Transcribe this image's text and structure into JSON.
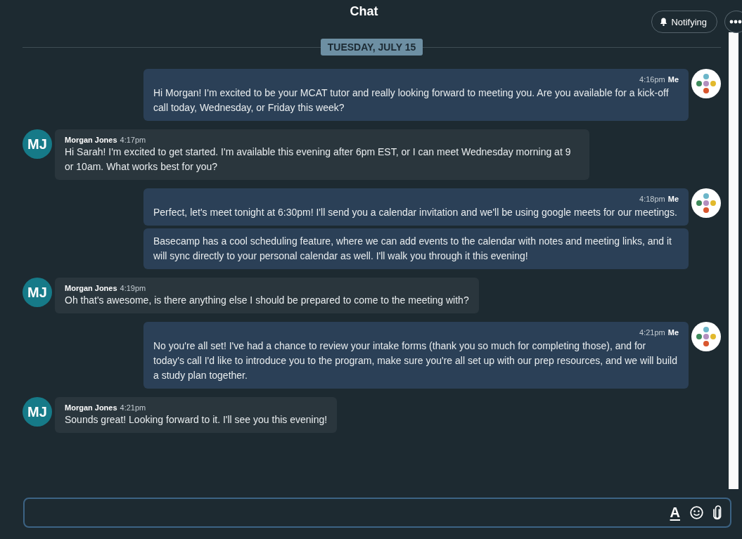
{
  "header": {
    "title": "Chat",
    "notify_button": "Notifying"
  },
  "date_divider": "TUESDAY, JULY 15",
  "messages": [
    {
      "kind": "me",
      "time": "4:16pm",
      "author": "Me",
      "bubbles": [
        "Hi Morgan! I'm excited to be your MCAT tutor and really looking forward to meeting you. Are you available for a kick-off call today, Wednesday, or Friday this week?"
      ]
    },
    {
      "kind": "other",
      "author": "Morgan Jones",
      "initials": "MJ",
      "time": "4:17pm",
      "bubbles": [
        "Hi Sarah! I'm excited to get started. I'm available this evening after 6pm EST, or I can meet Wednesday morning at 9 or 10am. What works best for you?"
      ]
    },
    {
      "kind": "me",
      "time": "4:18pm",
      "author": "Me",
      "bubbles": [
        "Perfect, let's meet tonight at 6:30pm! I'll send you a calendar invitation and we'll be using google meets for our meetings.",
        "Basecamp has a cool scheduling feature, where we can add events to the calendar with notes and meeting links, and it will sync directly to your personal calendar as well. I'll walk you through it this evening!"
      ]
    },
    {
      "kind": "other",
      "author": "Morgan Jones",
      "initials": "MJ",
      "time": "4:19pm",
      "bubbles": [
        "Oh that's awesome, is there anything else I should be prepared to come to the meeting with?"
      ]
    },
    {
      "kind": "me",
      "time": "4:21pm",
      "author": "Me",
      "bubbles": [
        "No you're all set! I've had a chance to review your intake forms (thank you so much for completing those), and for today's call I'd like to introduce you to the program, make sure you're all set up with our prep resources, and we will build a study plan together."
      ]
    },
    {
      "kind": "other",
      "author": "Morgan Jones",
      "initials": "MJ",
      "time": "4:21pm",
      "bubbles": [
        "Sounds great! Looking forward to it. I'll see you this evening!"
      ]
    }
  ],
  "composer": {
    "format_button": "A"
  }
}
